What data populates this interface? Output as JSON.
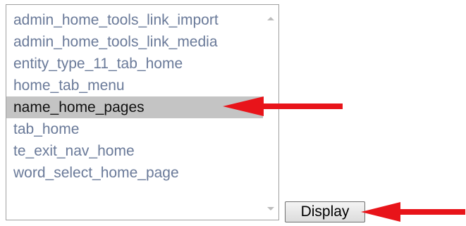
{
  "listbox": {
    "items": [
      {
        "label": "admin_home_tools_link_import",
        "selected": false
      },
      {
        "label": "admin_home_tools_link_media",
        "selected": false
      },
      {
        "label": "entity_type_11_tab_home",
        "selected": false
      },
      {
        "label": "home_tab_menu",
        "selected": false
      },
      {
        "label": "name_home_pages",
        "selected": true
      },
      {
        "label": "tab_home",
        "selected": false
      },
      {
        "label": "te_exit_nav_home",
        "selected": false
      },
      {
        "label": "word_select_home_page",
        "selected": false
      }
    ]
  },
  "display_button": {
    "label": "Display"
  },
  "colors": {
    "annotation_arrow": "#e8141a",
    "selected_row": "#c4c4c4",
    "item_text": "#6a7a99"
  },
  "icons": {
    "scroll_up": "scroll-up-arrow-icon",
    "scroll_down": "scroll-down-arrow-icon",
    "annotation": "red-arrow-icon"
  }
}
